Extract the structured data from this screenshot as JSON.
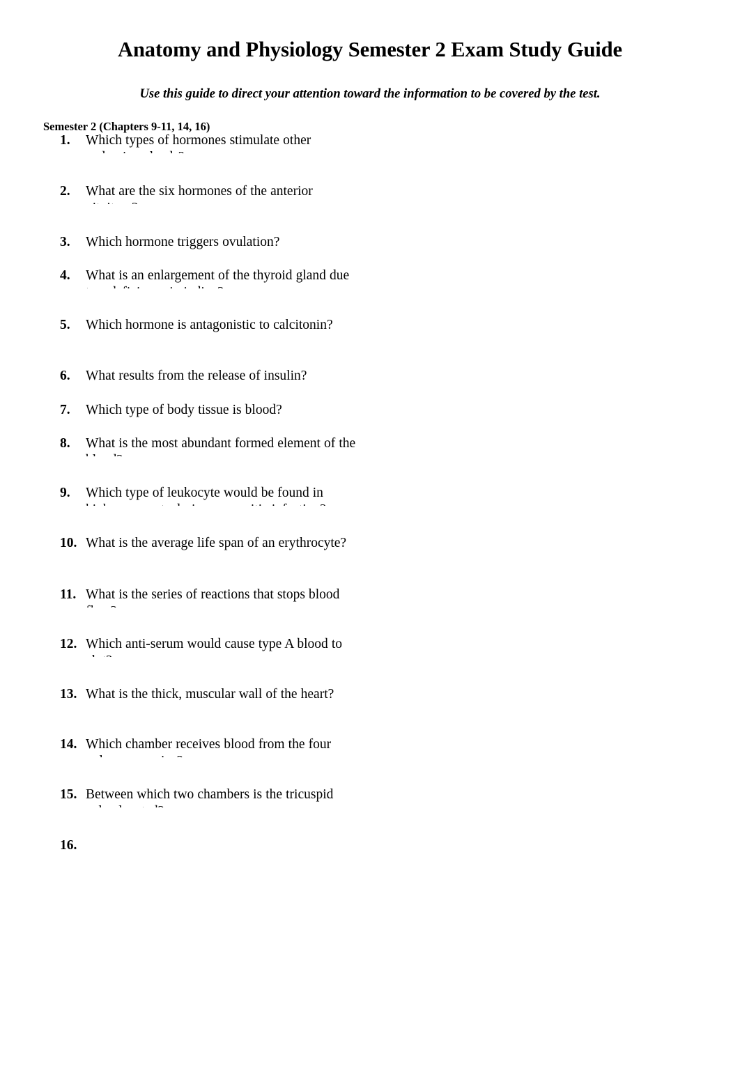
{
  "document": {
    "title": "Anatomy and Physiology Semester 2 Exam Study Guide",
    "subtitle": "Use this guide to direct your attention toward the information to be covered by the test.",
    "section_heading": "Semester 2 (Chapters 9-11, 14, 16)"
  },
  "left_column": {
    "items": [
      {
        "number": "1.",
        "text": "Which types of hormones stimulate other endocrine glands?"
      },
      {
        "number": "2.",
        "text": "What are the six hormones of the anterior pituitary?"
      },
      {
        "number": "3.",
        "text": "Which hormone triggers ovulation?"
      },
      {
        "number": "4.",
        "text": "What is an enlargement of the thyroid gland due to a deficiency in iodine?"
      },
      {
        "number": "5.",
        "text": "Which hormone is antagonistic to calcitonin?"
      },
      {
        "number": "6.",
        "text": "What results from the release of insulin?"
      },
      {
        "number": "7.",
        "text": "Which type of body tissue is blood?"
      },
      {
        "number": "8.",
        "text": "What is the most abundant formed element of the blood?"
      },
      {
        "number": "9.",
        "text": "Which type of leukocyte would be found in higher amounts during a parasitic infection?"
      },
      {
        "number": "10.",
        "text": "What is the average life span of an erythrocyte?"
      },
      {
        "number": "11.",
        "text": "What is the series of reactions that stops blood flow?"
      },
      {
        "number": "12.",
        "text": "Which anti-serum would cause type A blood to clot?"
      },
      {
        "number": "13.",
        "text": "What is the thick, muscular wall of the heart?"
      },
      {
        "number": "14.",
        "text": "Which chamber receives blood from the four pulmonary veins?"
      },
      {
        "number": "15.",
        "text": "Between which two chambers is the tricuspid valve located?"
      },
      {
        "number": "16.",
        "text": ""
      },
      {
        "number": "",
        "text": ""
      }
    ]
  },
  "right_column": {
    "items": [
      {
        "number": "",
        "text": ""
      },
      {
        "number": "",
        "text": ""
      },
      {
        "number": "",
        "text": ""
      },
      {
        "number": "",
        "text": ""
      },
      {
        "number": "",
        "text": ""
      },
      {
        "number": "",
        "text": ""
      },
      {
        "number": "",
        "text": ""
      },
      {
        "number": "",
        "text": ""
      },
      {
        "number": "",
        "text": ""
      },
      {
        "number": "",
        "text": ""
      },
      {
        "number": "",
        "text": ""
      },
      {
        "number": "",
        "text": ""
      },
      {
        "number": "",
        "text": ""
      },
      {
        "number": "",
        "text": ""
      },
      {
        "number": "",
        "text": ""
      },
      {
        "number": "",
        "text": ""
      },
      {
        "number": "",
        "text": ""
      },
      {
        "number": "",
        "text": ""
      }
    ]
  }
}
